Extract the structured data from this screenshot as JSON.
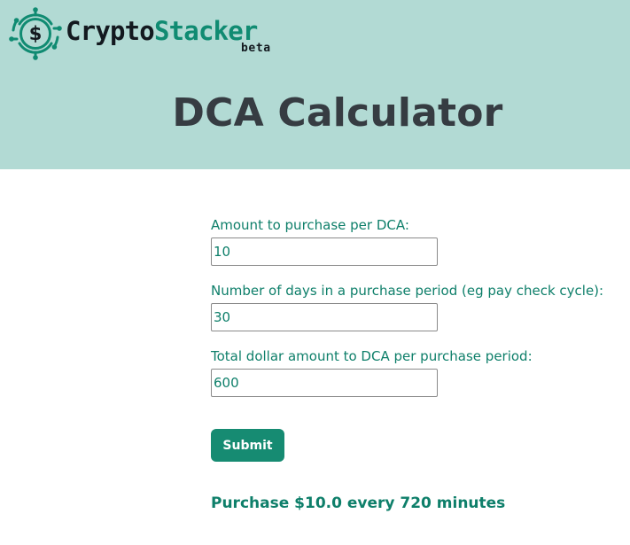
{
  "brand": {
    "name_part1": "Crypto",
    "name_part2": "Stacker",
    "tag": "beta",
    "logo_icon": "coin-circuit-logo-icon"
  },
  "colors": {
    "header_bg": "#b2dad4",
    "accent": "#168b72",
    "label_text": "#0e7f6a",
    "title_text": "#363c42"
  },
  "page": {
    "title": "DCA Calculator"
  },
  "form": {
    "amount_label": "Amount to purchase per DCA:",
    "amount_value": "10",
    "days_label": "Number of days in a purchase period (eg pay check cycle):",
    "days_value": "30",
    "total_label": "Total dollar amount to DCA per purchase period:",
    "total_value": "600",
    "submit_label": "Submit"
  },
  "result": {
    "text": "Purchase $10.0 every 720 minutes"
  }
}
